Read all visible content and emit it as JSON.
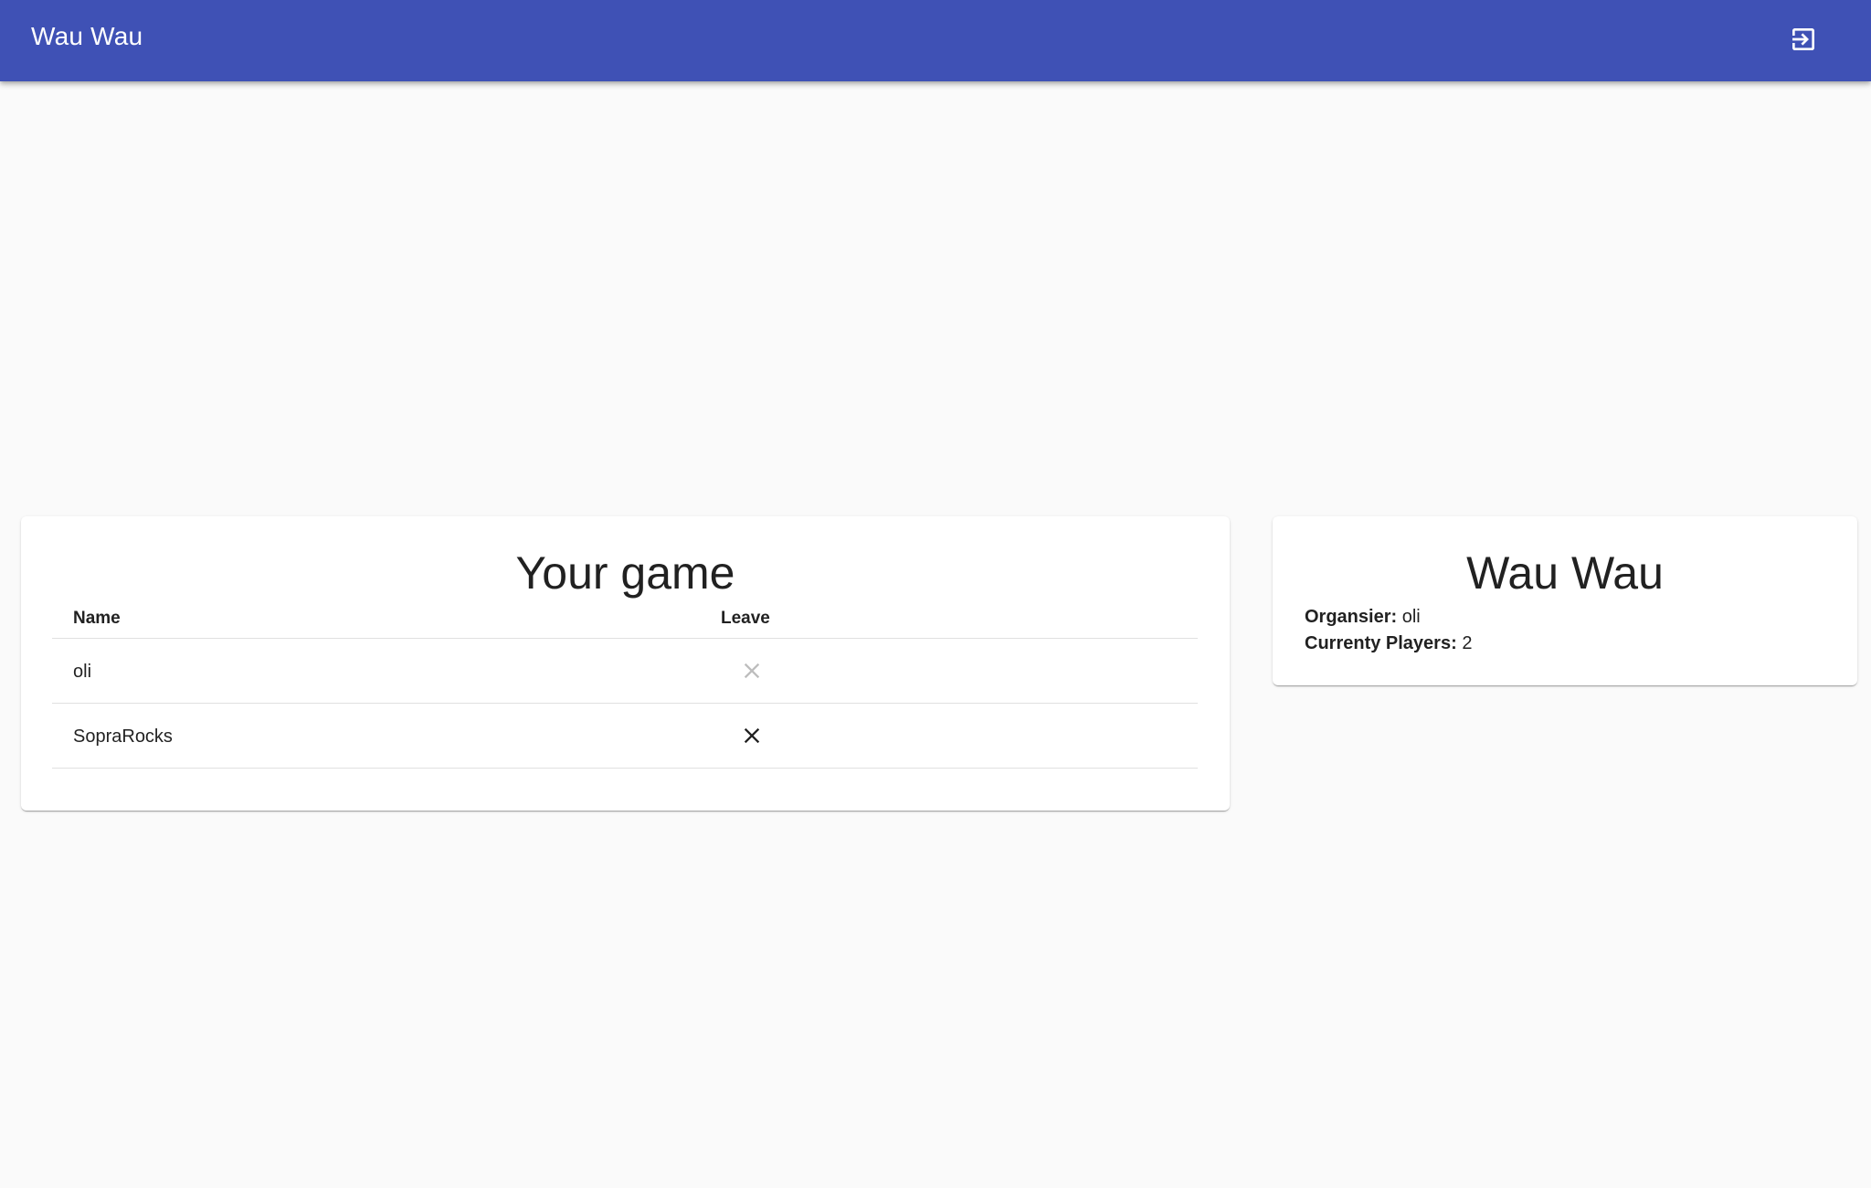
{
  "app_bar": {
    "title": "Wau Wau",
    "logout_icon": "exit-to-app-icon",
    "background_color": "#3f51b5"
  },
  "game_card": {
    "title": "Your game",
    "table": {
      "headers": [
        "Name",
        "Leave"
      ],
      "rows": [
        {
          "name": "oli",
          "leave_icon": "close-icon",
          "leave_enabled": false
        },
        {
          "name": "SopraRocks",
          "leave_icon": "close-icon",
          "leave_enabled": true
        }
      ]
    }
  },
  "info_card": {
    "title": "Wau Wau",
    "organiser_label": "Organsier:",
    "organiser_value": "oli",
    "players_label": "Currenty Players:",
    "players_value": "2"
  }
}
